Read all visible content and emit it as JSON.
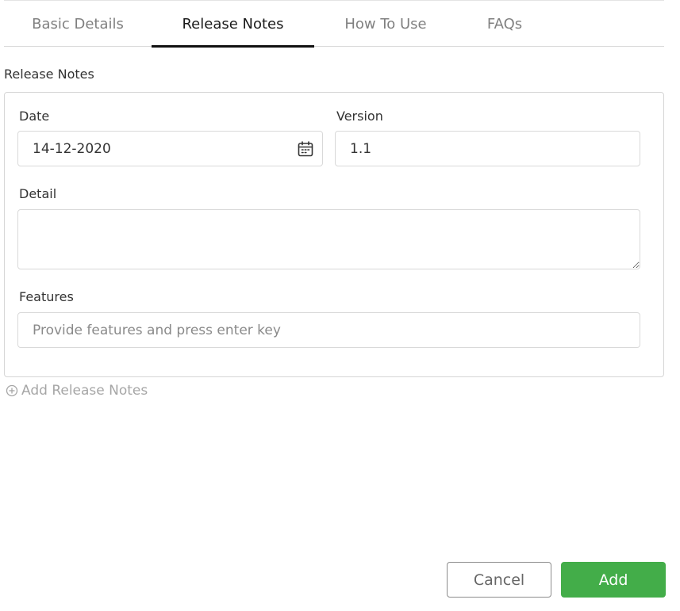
{
  "tabs": [
    {
      "label": "Basic Details",
      "active": false
    },
    {
      "label": "Release Notes",
      "active": true
    },
    {
      "label": "How To Use",
      "active": false
    },
    {
      "label": "FAQs",
      "active": false
    }
  ],
  "section": {
    "title": "Release Notes"
  },
  "form": {
    "date": {
      "label": "Date",
      "value": "14-12-2020",
      "icon": "calendar-icon"
    },
    "version": {
      "label": "Version",
      "value": "1.1"
    },
    "detail": {
      "label": "Detail",
      "value": ""
    },
    "features": {
      "label": "Features",
      "value": "",
      "placeholder": "Provide features and press enter key"
    }
  },
  "add_release_notes": {
    "label": "Add Release Notes",
    "icon": "plus-circle-icon"
  },
  "actions": {
    "cancel_label": "Cancel",
    "add_label": "Add"
  },
  "colors": {
    "accent": "#43ad49",
    "active_tab_underline": "#111111"
  }
}
